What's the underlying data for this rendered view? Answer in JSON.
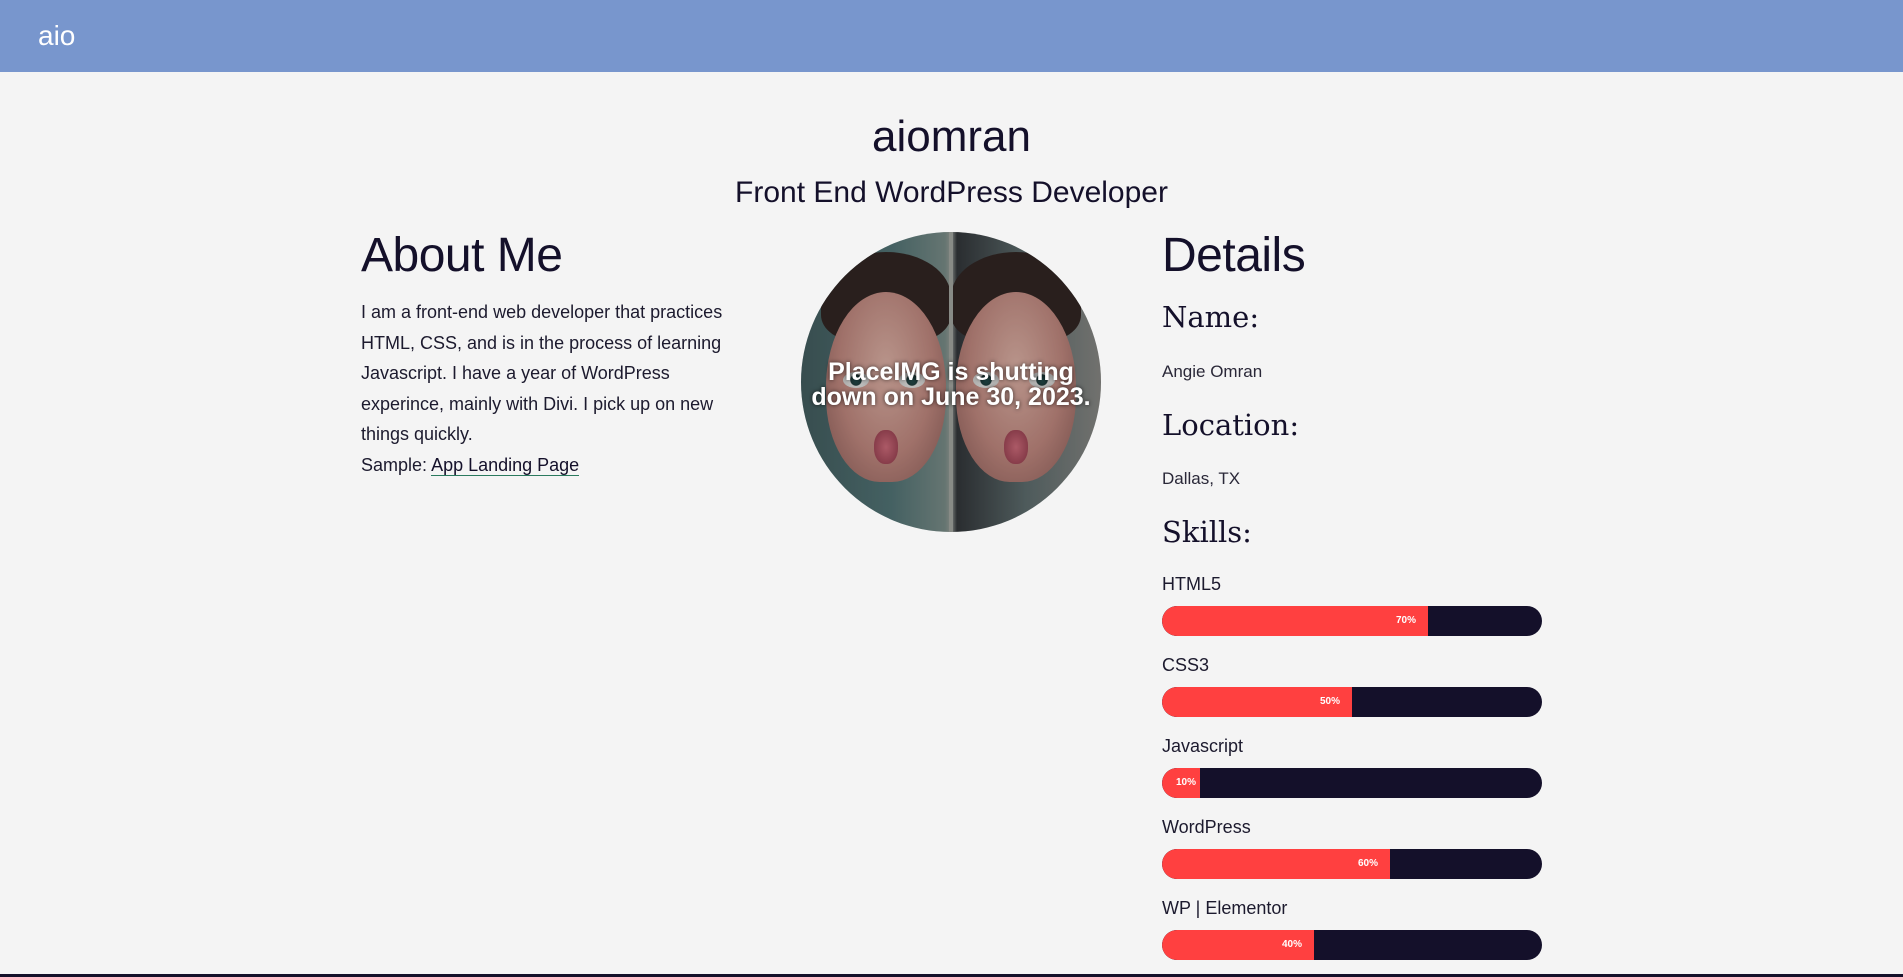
{
  "header": {
    "brand": "aio"
  },
  "hero": {
    "title": "aiomran",
    "subtitle": "Front End WordPress Developer"
  },
  "about": {
    "heading": "About Me",
    "body": "I am a front-end web developer that practices HTML, CSS, and is in the process of learning Javascript. I have a year of WordPress experince, mainly with Divi. I pick up on new things quickly.",
    "sample_label": "Sample:",
    "sample_link": "App Landing Page"
  },
  "photo": {
    "notice": "PlaceIMG is shutting down on June 30, 2023."
  },
  "details": {
    "heading": "Details",
    "name_label": "Name:",
    "name_value": "Angie Omran",
    "location_label": "Location:",
    "location_value": "Dallas, TX",
    "skills_label": "Skills:",
    "skills": [
      {
        "name": "HTML5",
        "percent": 70,
        "percent_label": "70%"
      },
      {
        "name": "CSS3",
        "percent": 50,
        "percent_label": "50%"
      },
      {
        "name": "Javascript",
        "percent": 10,
        "percent_label": "10%"
      },
      {
        "name": "WordPress",
        "percent": 60,
        "percent_label": "60%"
      },
      {
        "name": "WP | Elementor",
        "percent": 40,
        "percent_label": "40%"
      }
    ]
  },
  "colors": {
    "header_bg": "#7896cd",
    "page_bg": "#f4f4f4",
    "text": "#14102a",
    "bar_fill": "#ff4040",
    "bar_track": "#14102a"
  }
}
